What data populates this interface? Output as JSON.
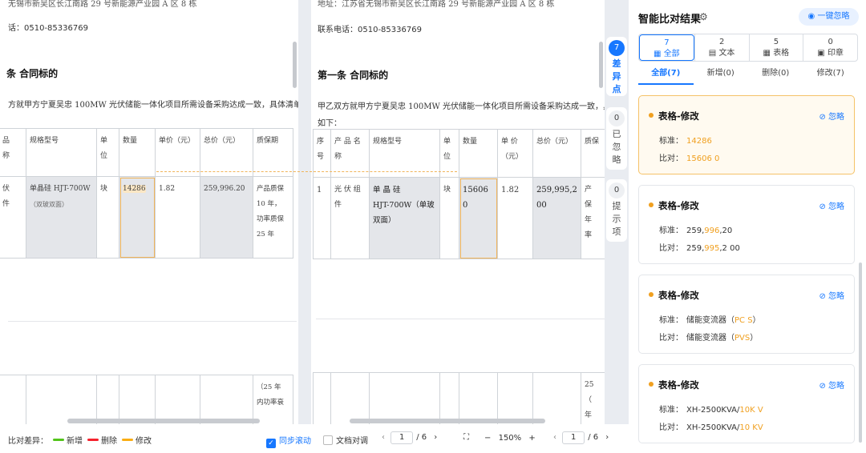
{
  "docA": {
    "address_partial": "无锡市新吴区长江南路 29 号新能源产业园 A 区 8 栋",
    "phone": "话：0510-85336769",
    "heading": "条  合同标的",
    "para1": "方就甲方宁夏吴忠 100MW 光伏储能一体化项目所需设备采购达成一致，具体清单",
    "table": {
      "headers": [
        "品\n称",
        "规格型号",
        "单\n位",
        "数量",
        "单价（元）",
        "总价（元）",
        "质保期"
      ],
      "row1": [
        "伏\n件",
        "单晶硅  HJT-700W",
        "（双玻双面）",
        "块",
        "14286",
        "1.82",
        "259,996.20",
        "产品质保\n10 年，\n功率质保\n25    年"
      ],
      "row2_fragment": "（25 年\n内功率衰"
    }
  },
  "docB": {
    "address": "地址：江苏省无锡市新吴区长江南路 29 号新能源产业园 A 区 8 栋",
    "phone": "联系电话：0510-85336769",
    "heading": "第一条  合同标的",
    "para1": "甲乙双方就甲方宁夏吴忠 100MW 光伏储能一体化项目所需设备采购达成一致，具体清",
    "para2": "如下：",
    "table": {
      "headers": [
        "序\n号",
        "产 品 名\n称",
        "规格型号",
        "单\n位",
        "数量",
        "单    价\n（元）",
        "总价（元）",
        "质保"
      ],
      "row1": [
        "1",
        "光 伏 组\n件",
        "单    晶    硅\nHJT-700W（单玻\n双面）",
        "块",
        "15606\n0",
        "1.82",
        "259,995,2\n00",
        "产\n保\n年\n率"
      ],
      "row2_fragment": "25\n（\n年"
    }
  },
  "side_tabs": [
    {
      "count": "7",
      "label": "差\n异\n点"
    },
    {
      "count": "0",
      "label": "已\n忽\n略"
    },
    {
      "count": "0",
      "label": "提\n示\n项"
    }
  ],
  "panel": {
    "title": "智能比对结果",
    "ignore_all": "一键忽略",
    "categories": [
      {
        "count": "7",
        "label": "全部"
      },
      {
        "count": "2",
        "label": "文本"
      },
      {
        "count": "5",
        "label": "表格"
      },
      {
        "count": "0",
        "label": "印章"
      }
    ],
    "subtabs": [
      "全部(7)",
      "新增(0)",
      "删除(0)",
      "修改(7)"
    ],
    "cards": [
      {
        "title": "表格-修改",
        "ignore": "忽略",
        "std_label": "标准：",
        "cmp_label": "比对：",
        "std_pre": "",
        "std_hl": "14286",
        "std_post": "",
        "cmp_pre": "",
        "cmp_hl": "15606 0",
        "cmp_post": ""
      },
      {
        "title": "表格-修改",
        "ignore": "忽略",
        "std_label": "标准：",
        "cmp_label": "比对：",
        "std_pre": "259,",
        "std_hl": "996",
        "std_post": ",20",
        "cmp_pre": "259,",
        "cmp_hl": "995",
        "cmp_post": ",2 00"
      },
      {
        "title": "表格-修改",
        "ignore": "忽略",
        "std_label": "标准：",
        "cmp_label": "比对：",
        "std_pre": "储能变流器（",
        "std_hl": "PC S",
        "std_post": "）",
        "cmp_pre": "储能变流器（",
        "cmp_hl": "PVS",
        "cmp_post": "）"
      },
      {
        "title": "表格-修改",
        "ignore": "忽略",
        "std_label": "标准：",
        "cmp_label": "比对：",
        "std_pre": "XH-2500KVA/",
        "std_hl": "10K V",
        "std_post": "",
        "cmp_pre": "XH-2500KVA/",
        "cmp_hl": "10 KV",
        "cmp_post": ""
      }
    ]
  },
  "bottom": {
    "legend_label": "比对差异：",
    "legend": [
      {
        "label": "新增",
        "color": "#52c41a"
      },
      {
        "label": "删除",
        "color": "#f5222d"
      },
      {
        "label": "修改",
        "color": "#faad14"
      }
    ],
    "sync_scroll": "同步滚动",
    "doc_compare": "文档对调",
    "page_left": "1",
    "page_total_left": "/ 6",
    "zoom": "150%",
    "page_right": "1",
    "page_total_right": "/ 6"
  },
  "colors": {
    "accent": "#1677ff",
    "modify": "#f0a020"
  }
}
